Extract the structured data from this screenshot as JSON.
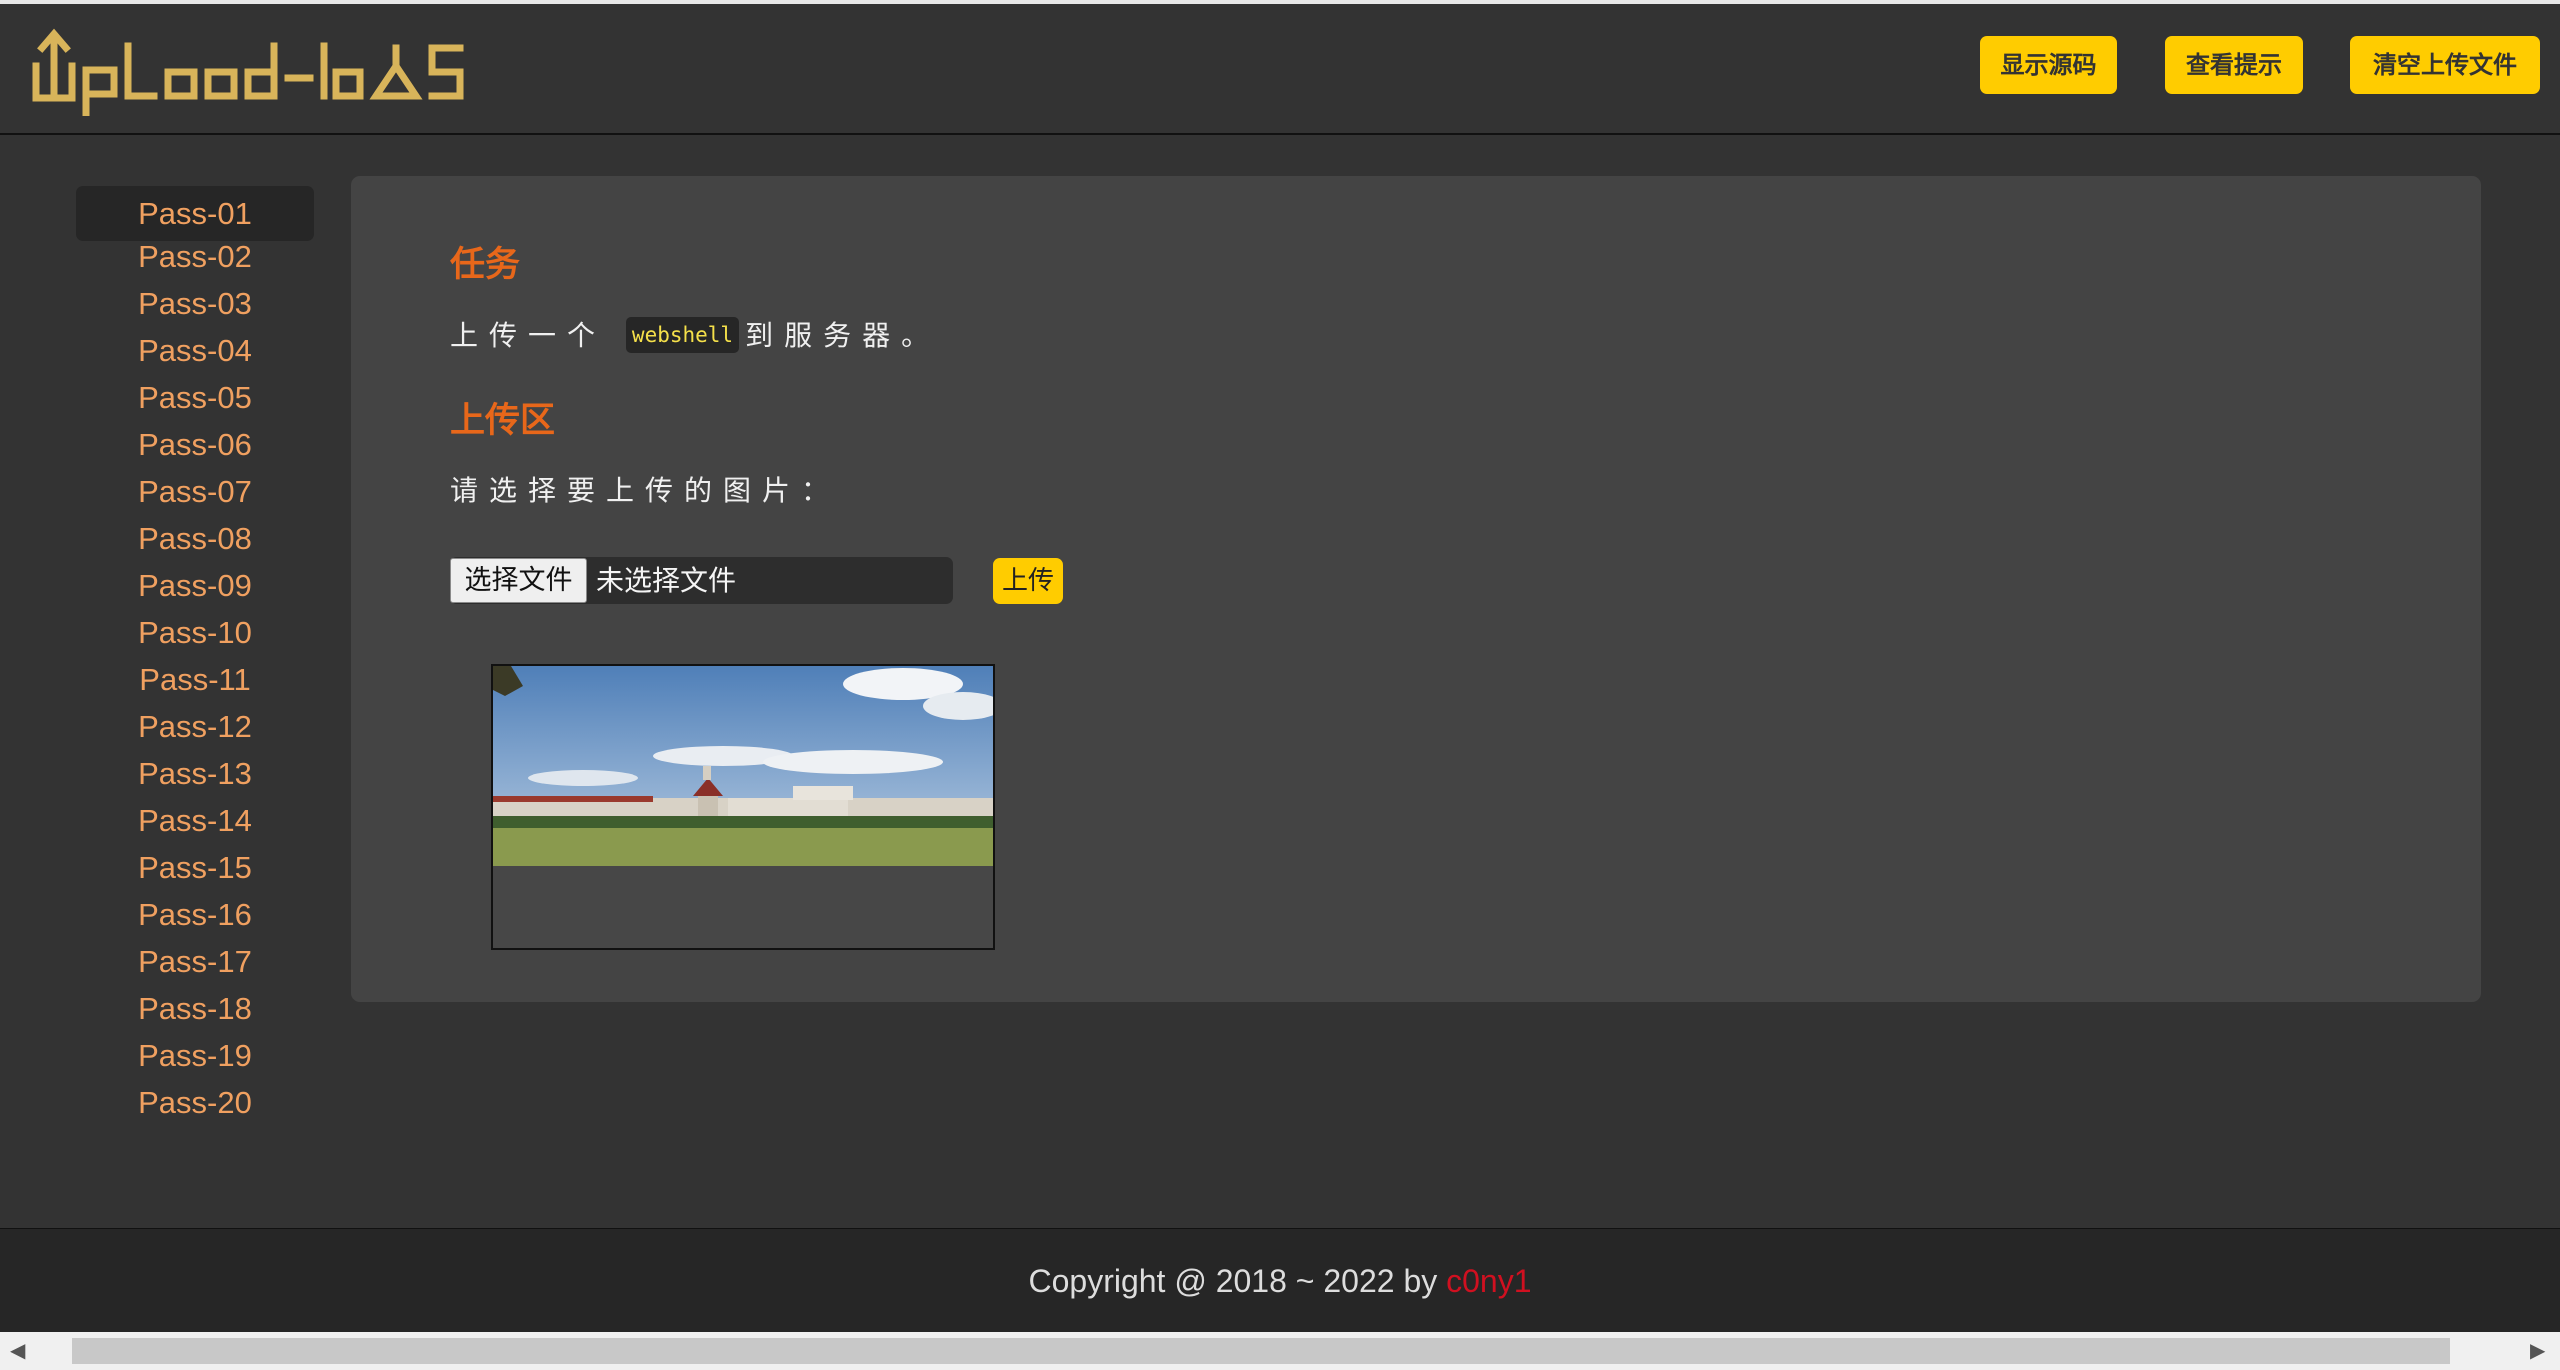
{
  "header": {
    "logo_alt": "UpLoad-labs",
    "buttons": {
      "show_source": "显示源码",
      "view_hint": "查看提示",
      "clear_uploads": "清空上传文件"
    }
  },
  "sidebar": {
    "items": [
      "Pass-01",
      "Pass-02",
      "Pass-03",
      "Pass-04",
      "Pass-05",
      "Pass-06",
      "Pass-07",
      "Pass-08",
      "Pass-09",
      "Pass-10",
      "Pass-11",
      "Pass-12",
      "Pass-13",
      "Pass-14",
      "Pass-15",
      "Pass-16",
      "Pass-17",
      "Pass-18",
      "Pass-19",
      "Pass-20"
    ],
    "active": "Pass-01"
  },
  "main": {
    "task_heading": "任务",
    "task_prefix": "上传一个",
    "task_code": "webshell",
    "task_suffix": "到服务器。",
    "upload_heading": "上传区",
    "choose_prompt": "请选择要上传的图片：",
    "file_button": "选择文件",
    "file_status": "未选择文件",
    "upload_button": "上传"
  },
  "footer": {
    "copyright": "Copyright @ 2018 ~ 2022 by ",
    "author": "c0ny1"
  },
  "colors": {
    "accent": "#ffcc00",
    "heading": "#e8671a",
    "nav_link": "#f0a060",
    "author": "#d01020"
  },
  "icons": [
    "scroll-left-arrow-icon",
    "scroll-right-arrow-icon"
  ]
}
